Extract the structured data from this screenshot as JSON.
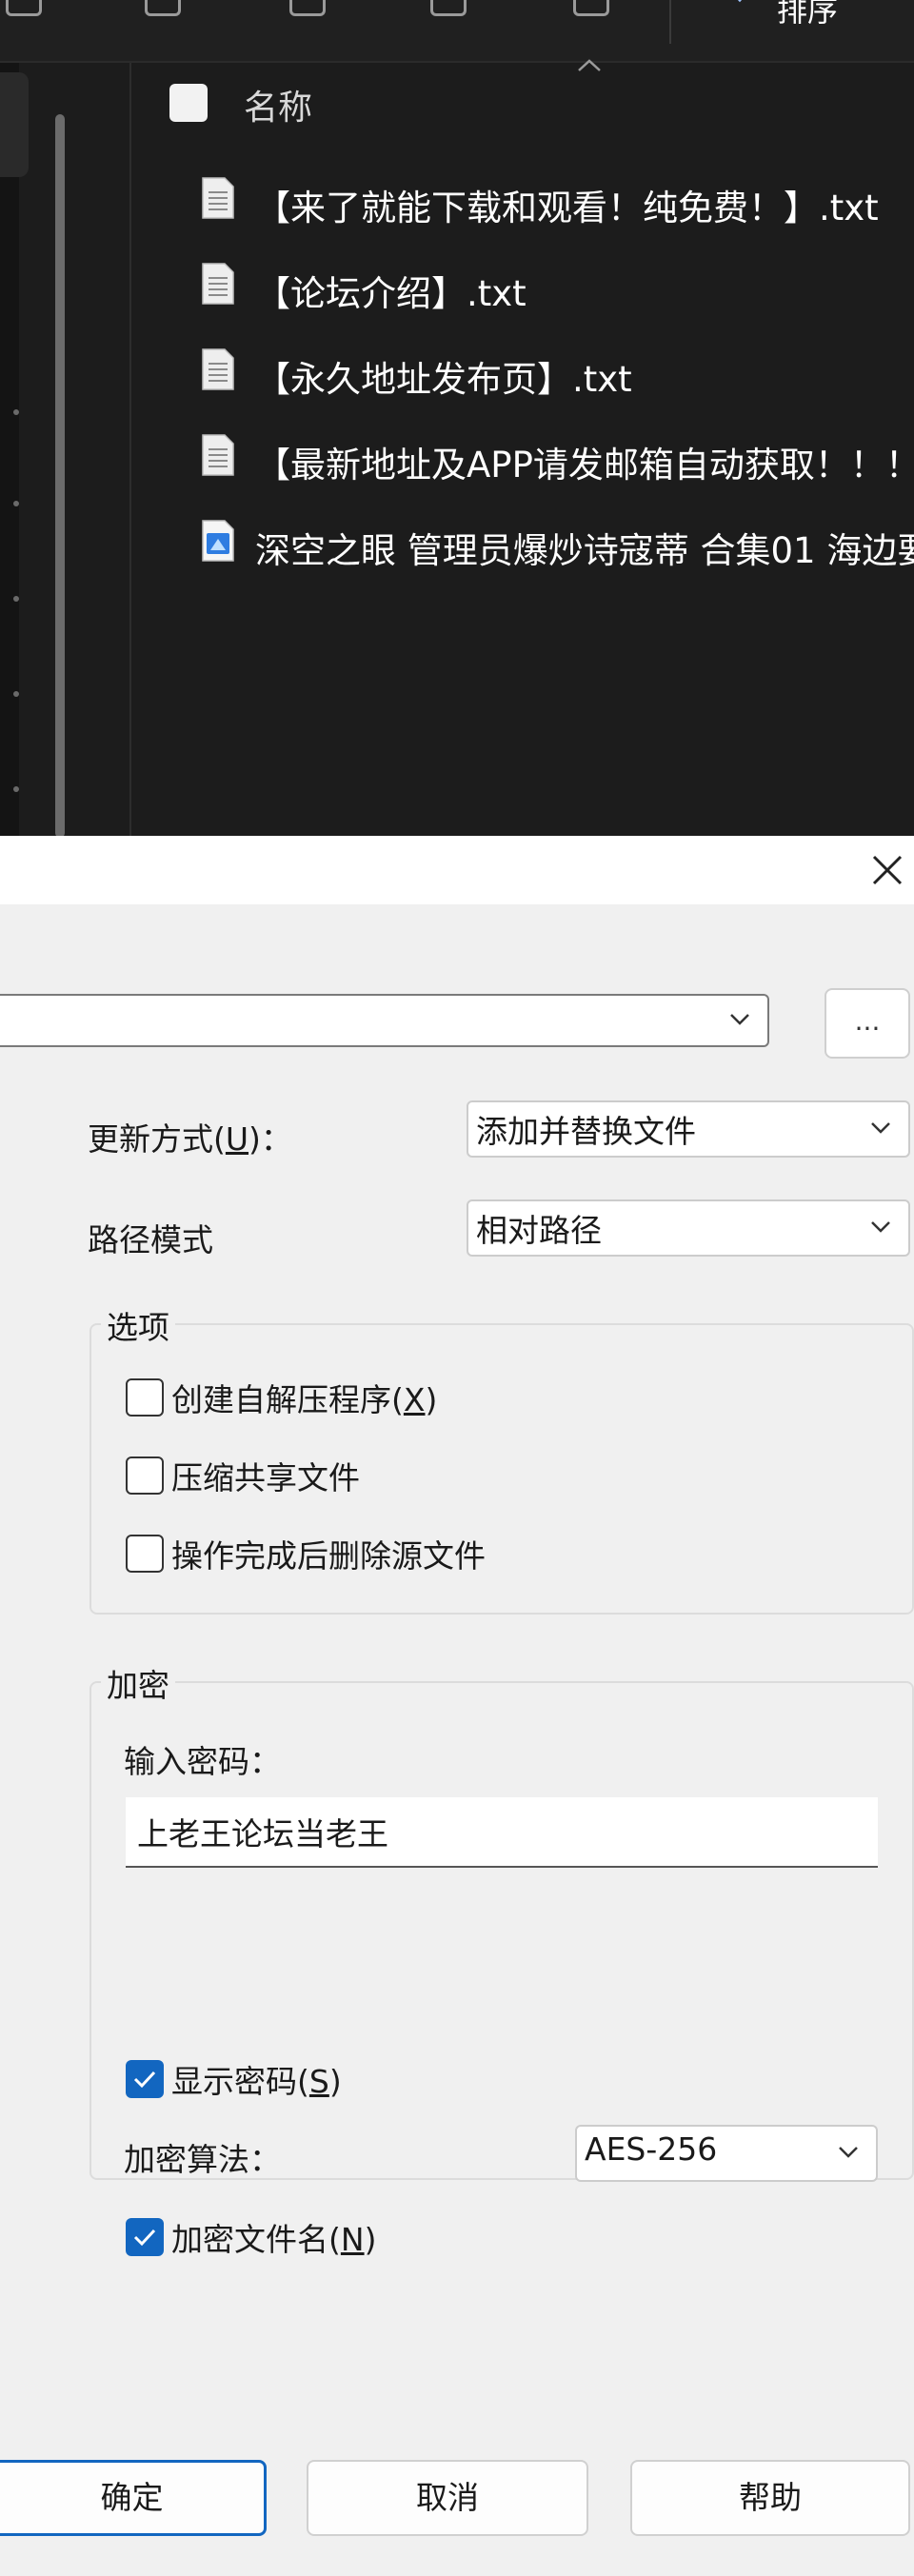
{
  "explorer": {
    "sort_label": "排序",
    "name_column_header": "名称",
    "files": [
      {
        "name": "【来了就能下载和观看！纯免费！】.txt",
        "icon": "text-file-icon"
      },
      {
        "name": "【论坛介绍】.txt",
        "icon": "text-file-icon"
      },
      {
        "name": "【永久地址发布页】.txt",
        "icon": "text-file-icon"
      },
      {
        "name": "【最新地址及APP请发邮箱自动获取！！！",
        "icon": "text-file-icon"
      },
      {
        "name": "深空之眼 管理员爆炒诗寇蒂 合集01 海边要",
        "icon": "video-file-icon"
      }
    ]
  },
  "dialog": {
    "archive_path_value": "",
    "browse_label": "...",
    "update_mode": {
      "label_pre": "更新方式(",
      "accel": "U",
      "label_post": ")：",
      "value": "添加并替换文件"
    },
    "path_mode": {
      "label": "路径模式",
      "value": "相对路径"
    },
    "options": {
      "title": "选项",
      "create_sfx": {
        "pre": "创建自解压程序(",
        "accel": "X",
        "post": ")",
        "checked": false
      },
      "compress_shared": {
        "label": "压缩共享文件",
        "checked": false
      },
      "delete_source": {
        "label": "操作完成后删除源文件",
        "checked": false
      }
    },
    "encryption": {
      "title": "加密",
      "password_label": "输入密码：",
      "password_value": "上老王论坛当老王",
      "show_password": {
        "pre": "显示密码(",
        "accel": "S",
        "post": ")",
        "checked": true
      },
      "algorithm_label": "加密算法：",
      "algorithm_value": "AES-256",
      "encrypt_filenames": {
        "pre": "加密文件名(",
        "accel": "N",
        "post": ")",
        "checked": true
      }
    },
    "buttons": {
      "ok": "确定",
      "cancel": "取消",
      "help": "帮助"
    }
  },
  "colors": {
    "accent": "#1266c0",
    "explorer_bg": "#1c1c1c",
    "dialog_bg": "#f0f0f0"
  }
}
